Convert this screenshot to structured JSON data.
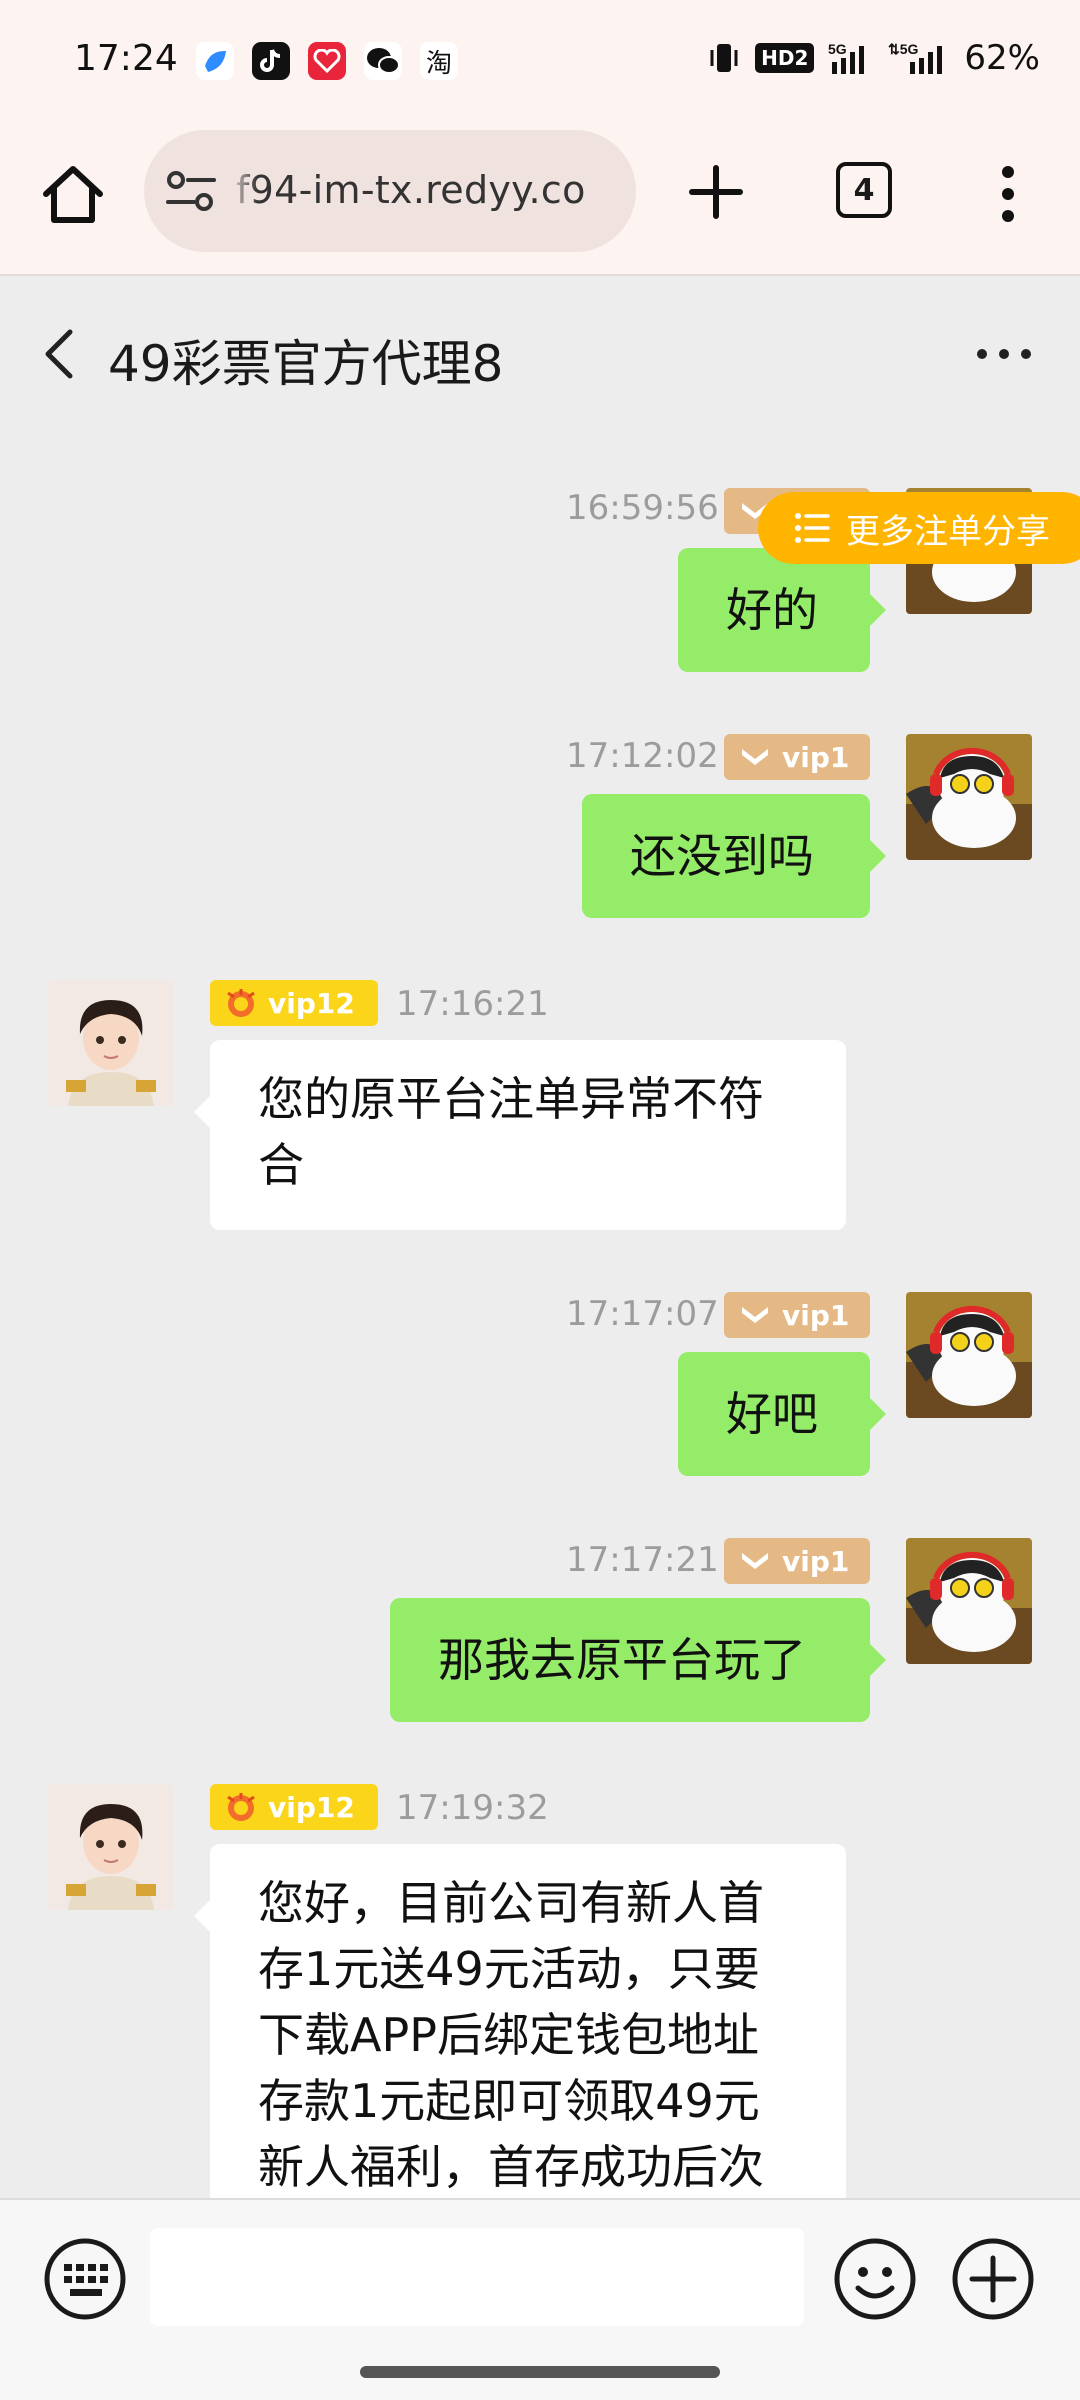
{
  "status_bar": {
    "time": "17:24",
    "app_icons": [
      "blue-app-icon",
      "tiktok-icon",
      "red-app-icon",
      "wechat-icon",
      "taobao-icon"
    ],
    "taobao_label": "淘",
    "battery": "62%",
    "network_1": "5G",
    "network_2": "5G",
    "hd_label": "HD2"
  },
  "browser": {
    "url": "f94-im-tx.redyy.co",
    "tab_count": "4"
  },
  "chat": {
    "title": "49彩票官方代理8",
    "share_button": "更多注单分享",
    "messages": [
      {
        "side": "out",
        "time": "16:59:56",
        "badge": "vip1",
        "text": "好的"
      },
      {
        "side": "out",
        "time": "17:12:02",
        "badge": "vip1",
        "text": "还没到吗"
      },
      {
        "side": "in",
        "time": "17:16:21",
        "badge": "vip12",
        "text": "您的原平台注单异常不符合"
      },
      {
        "side": "out",
        "time": "17:17:07",
        "badge": "vip1",
        "text": "好吧"
      },
      {
        "side": "out",
        "time": "17:17:21",
        "badge": "vip1",
        "text": "那我去原平台玩了"
      },
      {
        "side": "in",
        "time": "17:19:32",
        "badge": "vip12",
        "text": "您好，目前公司有新人首存1元送49元活动，只要下载APP后绑定钱包地址存款1元起即可领取49元新人福利，首存成功后次"
      }
    ]
  },
  "input": {
    "placeholder": ""
  },
  "colors": {
    "outgoing_bubble": "#95ec69",
    "incoming_bubble": "#ffffff",
    "share_pill": "#ffb400",
    "vip_user_badge": "#e5b985",
    "vip_agent_badge": "#fbd51a"
  }
}
